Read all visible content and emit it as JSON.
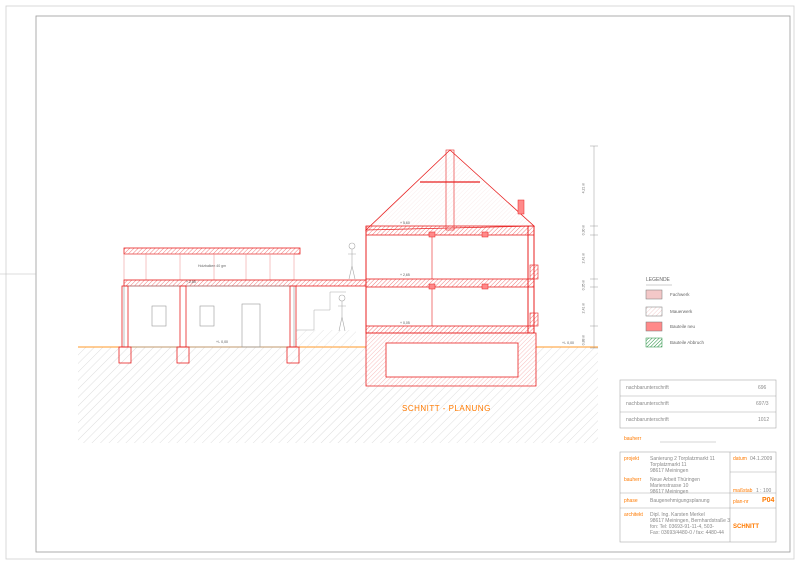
{
  "drawing": {
    "title": "SCHNITT - PLANUNG",
    "terrace_label": "Holzbalken 40 gm",
    "level_tags": [
      "+/- 0,00",
      "+/- 0,00",
      "+ 2,65",
      "+ 5,60",
      "+ 0,05",
      "+ 2,85"
    ],
    "dimension_labels": [
      "4,21 m",
      "0,30 m",
      "2,41 m",
      "0,35 m",
      "2,41 m",
      "0,88 m"
    ]
  },
  "legend": {
    "title": "LEGENDE",
    "items": [
      {
        "label": "Fachwerk",
        "color": "#f3c8c8"
      },
      {
        "label": "Mauerwerk",
        "color": "#ffffff"
      },
      {
        "label": "Bauteile neu",
        "color": "#ff8a8a"
      },
      {
        "label": "Bauteile Abbruch",
        "color": "#1e8c3a"
      }
    ]
  },
  "title_block": {
    "signatures": [
      {
        "label": "nachbarunterschrift",
        "value": "696"
      },
      {
        "label": "nachbarunterschrift",
        "value": "697/3"
      },
      {
        "label": "nachbarunterschrift",
        "value": "1012"
      }
    ],
    "bauherr_label": "bauherr",
    "projekt_label": "projekt",
    "projekt_lines": [
      "Sanierung 2 Torplatzmarkt 11",
      "Torplatzmarkt 11",
      "98617 Meiningen"
    ],
    "datum_label": "datum",
    "datum_value": "04.1.2009",
    "bauherr2_label": "bauherr",
    "bauherr2_lines": [
      "Neue Arbeit Thüringen",
      "Marienstrasse 10",
      "98617 Meiningen"
    ],
    "massstab_label": "maßstab",
    "massstab_value": "1 : 100",
    "plan_label": "plan-nr",
    "plan_value": "P04",
    "phase_label": "phase",
    "phase_value": "Baugenehmigungsplanung",
    "architekt_label": "architekt",
    "architekt_lines": [
      "Dipl. Ing. Karsten Merkel",
      "98617 Meiningen, Bernhardstraße 3",
      "fon: Tel: 03693-91-11-4, 503-",
      "Fax: 03693/4480-0 / fax: 4480-44"
    ],
    "schnitt_label": "SCHNITT"
  }
}
